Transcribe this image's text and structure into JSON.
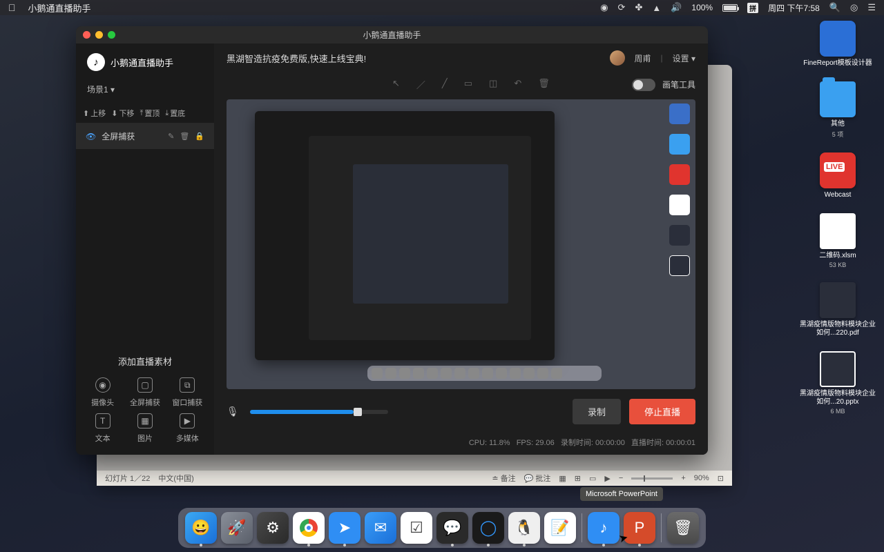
{
  "menubar": {
    "app_name": "小鹅通直播助手",
    "battery_pct": "100%",
    "datetime": "周四 下午7:58"
  },
  "desktop": {
    "finereport": "FineReport模板设计器",
    "other_folder": "其他",
    "other_folder_sub": "5 项",
    "webcast": "Webcast",
    "xlsm_name": "二维码.xlsm",
    "xlsm_size": "53 KB",
    "pdf_name": "黑湖疫情版物料模块企业如何...220.pdf",
    "pptx_name": "黑湖疫情版物料模块企业如何...20.pptx",
    "pptx_size": "6 MB"
  },
  "ppt": {
    "slide_info": "幻灯片 1／22",
    "lang": "中文(中国)",
    "notes": "备注",
    "comments": "批注",
    "zoom": "90%"
  },
  "app": {
    "title": "小鹅通直播助手",
    "logo_text": "小鹅通直播助手",
    "scene1_label": "场景1 ▾",
    "move_up": "上移",
    "move_down": "下移",
    "to_top": "置顶",
    "to_bottom": "置底",
    "source_fullscreen": "全屏捕获",
    "add_section_title": "添加直播素材",
    "src_cam": "摄像头",
    "src_fullscreen": "全屏捕获",
    "src_window": "窗口捕获",
    "src_text": "文本",
    "src_image": "图片",
    "src_media": "多媒体",
    "banner": "黑湖智造抗疫免费版,快速上线宝典!",
    "user_name": "周甫",
    "settings": "设置 ▾",
    "brush_toggle_label": "画笔工具",
    "record_btn": "录制",
    "stop_btn": "停止直播",
    "cpu": "CPU: 11.8%",
    "fps": "FPS: 29.06",
    "rec_time_label": "录制时间:",
    "rec_time": "00:00:00",
    "live_time_label": "直播时间:",
    "live_time": "00:00:01"
  },
  "tooltip": "Microsoft PowerPoint",
  "dock_tooltip_inner": "Microsoft PowerPoint"
}
